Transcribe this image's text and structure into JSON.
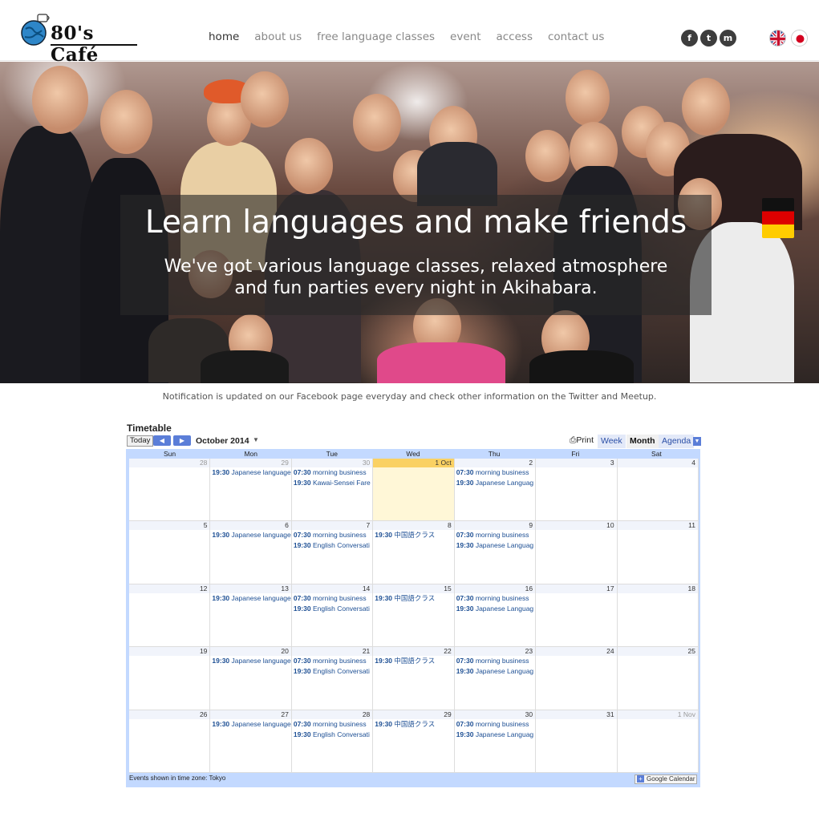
{
  "header": {
    "logo_text": "80's Café",
    "nav": [
      "home",
      "about us",
      "free language classes",
      "event",
      "access",
      "contact us"
    ],
    "active_nav": "home",
    "social_icons": [
      "facebook-icon",
      "twitter-icon",
      "meetup-icon"
    ],
    "social_glyphs": [
      "f",
      "t",
      "m"
    ],
    "flags": [
      "uk-flag-icon",
      "japan-flag-icon"
    ]
  },
  "hero": {
    "title": "Learn languages and make friends",
    "subtitle_line1": "We've got various language classes, relaxed atmosphere",
    "subtitle_line2": "and fun parties every night in Akihabara."
  },
  "notice": "Notification is updated on our Facebook page everyday and check other information on the Twitter and Meetup.",
  "calendar": {
    "title": "Timetable",
    "today_label": "Today",
    "month_label": "October 2014",
    "print_label": "Print",
    "views": [
      "Week",
      "Month",
      "Agenda"
    ],
    "selected_view": "Month",
    "weekdays": [
      "Sun",
      "Mon",
      "Tue",
      "Wed",
      "Thu",
      "Fri",
      "Sat"
    ],
    "weeks": [
      [
        {
          "day": "28",
          "other": true,
          "events": []
        },
        {
          "day": "29",
          "other": true,
          "events": [
            {
              "time": "19:30",
              "title": "Japanese language"
            }
          ]
        },
        {
          "day": "30",
          "other": true,
          "events": [
            {
              "time": "07:30",
              "title": "morning business"
            },
            {
              "time": "19:30",
              "title": "Kawai-Sensei Fare"
            }
          ]
        },
        {
          "day": "1 Oct",
          "today": true,
          "events": []
        },
        {
          "day": "2",
          "events": [
            {
              "time": "07:30",
              "title": "morning business"
            },
            {
              "time": "19:30",
              "title": "Japanese Languag"
            }
          ]
        },
        {
          "day": "3",
          "events": []
        },
        {
          "day": "4",
          "events": []
        }
      ],
      [
        {
          "day": "5",
          "events": []
        },
        {
          "day": "6",
          "events": [
            {
              "time": "19:30",
              "title": "Japanese language"
            }
          ]
        },
        {
          "day": "7",
          "events": [
            {
              "time": "07:30",
              "title": "morning business"
            },
            {
              "time": "19:30",
              "title": "English Conversati"
            }
          ]
        },
        {
          "day": "8",
          "events": [
            {
              "time": "19:30",
              "title": "中国語クラス"
            }
          ]
        },
        {
          "day": "9",
          "events": [
            {
              "time": "07:30",
              "title": "morning business"
            },
            {
              "time": "19:30",
              "title": "Japanese Languag"
            }
          ]
        },
        {
          "day": "10",
          "events": []
        },
        {
          "day": "11",
          "events": []
        }
      ],
      [
        {
          "day": "12",
          "events": []
        },
        {
          "day": "13",
          "events": [
            {
              "time": "19:30",
              "title": "Japanese language"
            }
          ]
        },
        {
          "day": "14",
          "events": [
            {
              "time": "07:30",
              "title": "morning business"
            },
            {
              "time": "19:30",
              "title": "English Conversati"
            }
          ]
        },
        {
          "day": "15",
          "events": [
            {
              "time": "19:30",
              "title": "中国語クラス"
            }
          ]
        },
        {
          "day": "16",
          "events": [
            {
              "time": "07:30",
              "title": "morning business"
            },
            {
              "time": "19:30",
              "title": "Japanese Languag"
            }
          ]
        },
        {
          "day": "17",
          "events": []
        },
        {
          "day": "18",
          "events": []
        }
      ],
      [
        {
          "day": "19",
          "events": []
        },
        {
          "day": "20",
          "events": [
            {
              "time": "19:30",
              "title": "Japanese language"
            }
          ]
        },
        {
          "day": "21",
          "events": [
            {
              "time": "07:30",
              "title": "morning business"
            },
            {
              "time": "19:30",
              "title": "English Conversati"
            }
          ]
        },
        {
          "day": "22",
          "events": [
            {
              "time": "19:30",
              "title": "中国語クラス"
            }
          ]
        },
        {
          "day": "23",
          "events": [
            {
              "time": "07:30",
              "title": "morning business"
            },
            {
              "time": "19:30",
              "title": "Japanese Languag"
            }
          ]
        },
        {
          "day": "24",
          "events": []
        },
        {
          "day": "25",
          "events": []
        }
      ],
      [
        {
          "day": "26",
          "events": []
        },
        {
          "day": "27",
          "events": [
            {
              "time": "19:30",
              "title": "Japanese language"
            }
          ]
        },
        {
          "day": "28",
          "events": [
            {
              "time": "07:30",
              "title": "morning business"
            },
            {
              "time": "19:30",
              "title": "English Conversati"
            }
          ]
        },
        {
          "day": "29",
          "events": [
            {
              "time": "19:30",
              "title": "中国語クラス"
            }
          ]
        },
        {
          "day": "30",
          "events": [
            {
              "time": "07:30",
              "title": "morning business"
            },
            {
              "time": "19:30",
              "title": "Japanese Languag"
            }
          ]
        },
        {
          "day": "31",
          "events": []
        },
        {
          "day": "1 Nov",
          "other": true,
          "events": []
        }
      ]
    ],
    "timezone_note": "Events shown in time zone: Tokyo",
    "gcal_button": "Google Calendar"
  }
}
